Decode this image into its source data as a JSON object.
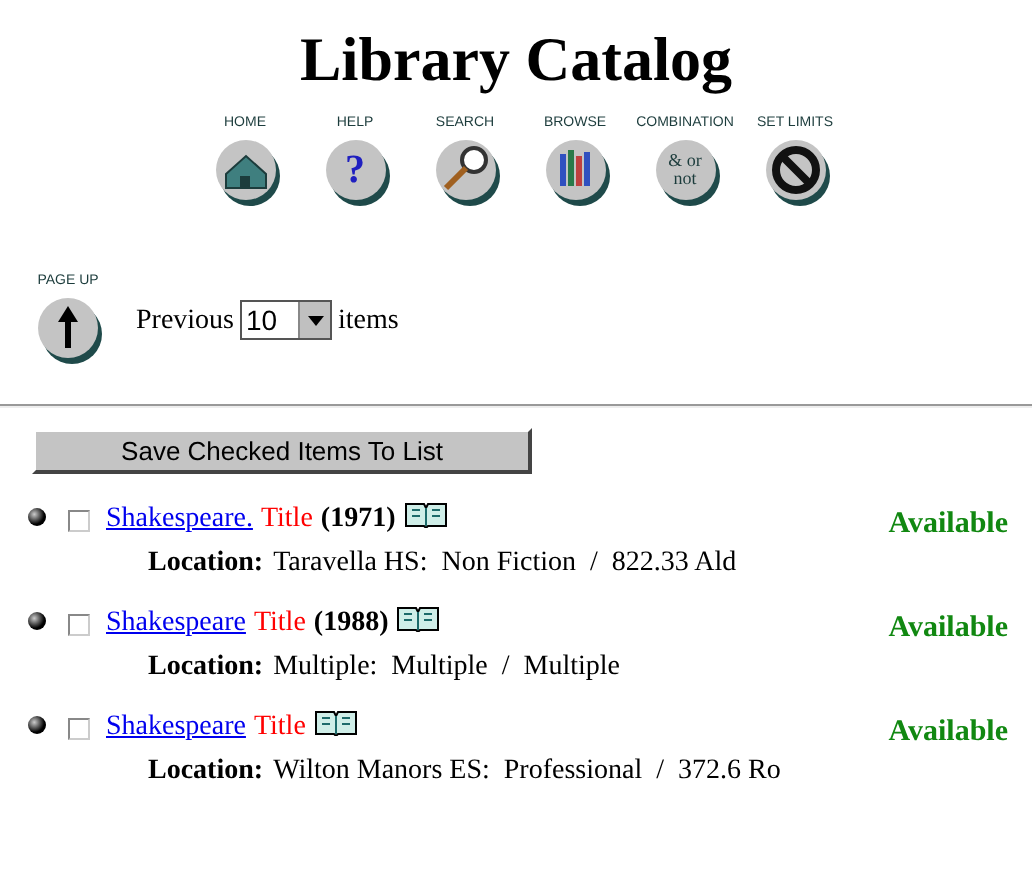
{
  "title": "Library Catalog",
  "nav": [
    {
      "label": "HOME",
      "kind": "home"
    },
    {
      "label": "HELP",
      "kind": "help",
      "glyph": "?"
    },
    {
      "label": "SEARCH",
      "kind": "search"
    },
    {
      "label": "BROWSE",
      "kind": "browse"
    },
    {
      "label": "COMBINATION",
      "kind": "combination",
      "glyph": "& or not"
    },
    {
      "label": "SET LIMITS",
      "kind": "limits"
    }
  ],
  "page_up": {
    "label": "PAGE UP"
  },
  "previous": {
    "label": "Previous",
    "value": "10",
    "suffix": "items"
  },
  "save_button": "Save Checked Items To List",
  "results": [
    {
      "author": "Shakespeare.",
      "title": "Title",
      "year": "(1971)",
      "checked": false,
      "status": "Available",
      "location_label": "Location:",
      "location": "Taravella HS:  Non Fiction  /  822.33 Ald"
    },
    {
      "author": "Shakespeare",
      "title": "Title",
      "year": "(1988)",
      "checked": false,
      "status": "Available",
      "location_label": "Location:",
      "location": "Multiple:  Multiple  /  Multiple"
    },
    {
      "author": "Shakespeare",
      "title": "Title",
      "checked": false,
      "status": "Available",
      "location_label": "Location:",
      "location": "Wilton Manors ES:  Professional  /  372.6 Ro"
    }
  ]
}
